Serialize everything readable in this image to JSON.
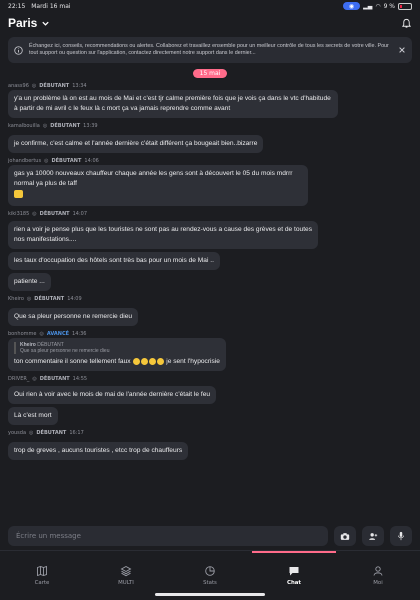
{
  "status_bar": {
    "time": "22:15",
    "date": "Mardi 16 mai",
    "battery": "9 %"
  },
  "header": {
    "title": "Paris"
  },
  "banner": {
    "text": "Échangez ici, conseils, recommendations ou alertes. Collaborez et travaillez ensemble pour un meilleur contrôle de tous les secrets de votre ville. Pour tout support ou question sur l'application, contactez directement notre support dans le dernier..."
  },
  "date_separator": "15 mai",
  "messages": [
    {
      "user": "anass96",
      "level": "DÉBUTANT",
      "time": "13:34",
      "text": "y'a un problème là on est au mois de Mai et c'est tjr calme première fois que je vois ça dans le vtc d'habitude à partir de mi avril c le feux là c mort ça va jamais reprendre comme avant"
    },
    {
      "user": "kamalbouilla",
      "level": "DÉBUTANT",
      "time": "13:39",
      "text": "je confirme, c'est calme et l'année dernière c'était différent ça bougeait bien..bizarre"
    },
    {
      "user": "johandbertus",
      "level": "DÉBUTANT",
      "time": "14:06",
      "text": "gas ya 10000 nouveaux chauffeur chaque année les gens sont à découvert le 05 du mois mdrrr normal ya plus de taff"
    },
    {
      "user": "kiki3185",
      "level": "DÉBUTANT",
      "time": "14:07",
      "texts": [
        "rien a voir je pense plus que les touristes ne sont pas au rendez-vous a cause des grèves et de toutes nos manifestations....",
        "les taux d'occupation des hôtels sont très bas pour un mois de Mai ..",
        "patiente ..."
      ]
    },
    {
      "user": "Kheiro",
      "level": "DÉBUTANT",
      "time": "14:09",
      "text": "Que sa pleur personne ne remercie dieu"
    },
    {
      "user": "bonhomme",
      "level": "AVANCÉ",
      "time": "14:36",
      "quote_name": "Kheiro",
      "quote_level": "DÉBUTANT",
      "quote_text": "Que sa pleur personne ne remercie dieu",
      "text_a": "ton commentaire il sonne tellement faux",
      "text_b": "je sent l'hypocrisie"
    },
    {
      "user": "DRIVER_",
      "level": "DÉBUTANT",
      "time": "14:55",
      "texts": [
        "Oui rien à voir avec le mois de mai de l'année dernière c'était le feu",
        "Là c'est mort"
      ]
    },
    {
      "user": "yousda",
      "level": "DÉBUTANT",
      "time": "16:17",
      "text": "trop de greves , aucuns touristes , etcc trop de chauffeurs"
    }
  ],
  "composer": {
    "placeholder": "Écrire un message"
  },
  "tabs": [
    {
      "label": "Carte",
      "icon": "map-icon"
    },
    {
      "label": "MULTI",
      "icon": "layers-icon"
    },
    {
      "label": "Stats",
      "icon": "chart-icon"
    },
    {
      "label": "Chat",
      "icon": "chat-icon"
    },
    {
      "label": "Moi",
      "icon": "person-icon"
    }
  ],
  "colors": {
    "accent": "#ff6b8a",
    "advanced": "#4a90e2",
    "background": "#1c1d21",
    "bubble": "#2e3037"
  }
}
